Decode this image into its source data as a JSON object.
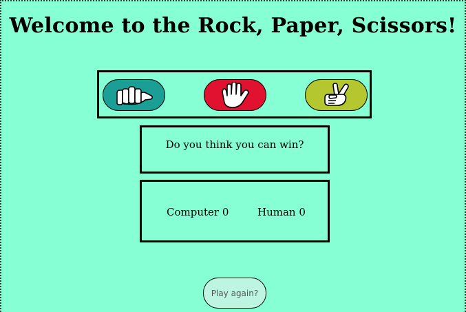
{
  "page": {
    "title": "Welcome to the Rock, Paper, Scissors!"
  },
  "choices": [
    {
      "name": "rock",
      "icon": "fist-icon",
      "color": "#1b9e96"
    },
    {
      "name": "paper",
      "icon": "open-hand-icon",
      "color": "#e0122f"
    },
    {
      "name": "scissors",
      "icon": "peace-hand-icon",
      "color": "#b4c72e"
    }
  ],
  "message": {
    "text": "Do you think you can win?"
  },
  "score": {
    "computer_label": "Computer 0",
    "human_label": "Human 0"
  },
  "actions": {
    "play_again_label": "Play again?"
  },
  "colors": {
    "background": "#86ffd4",
    "button_light": "#bdf5e2"
  }
}
